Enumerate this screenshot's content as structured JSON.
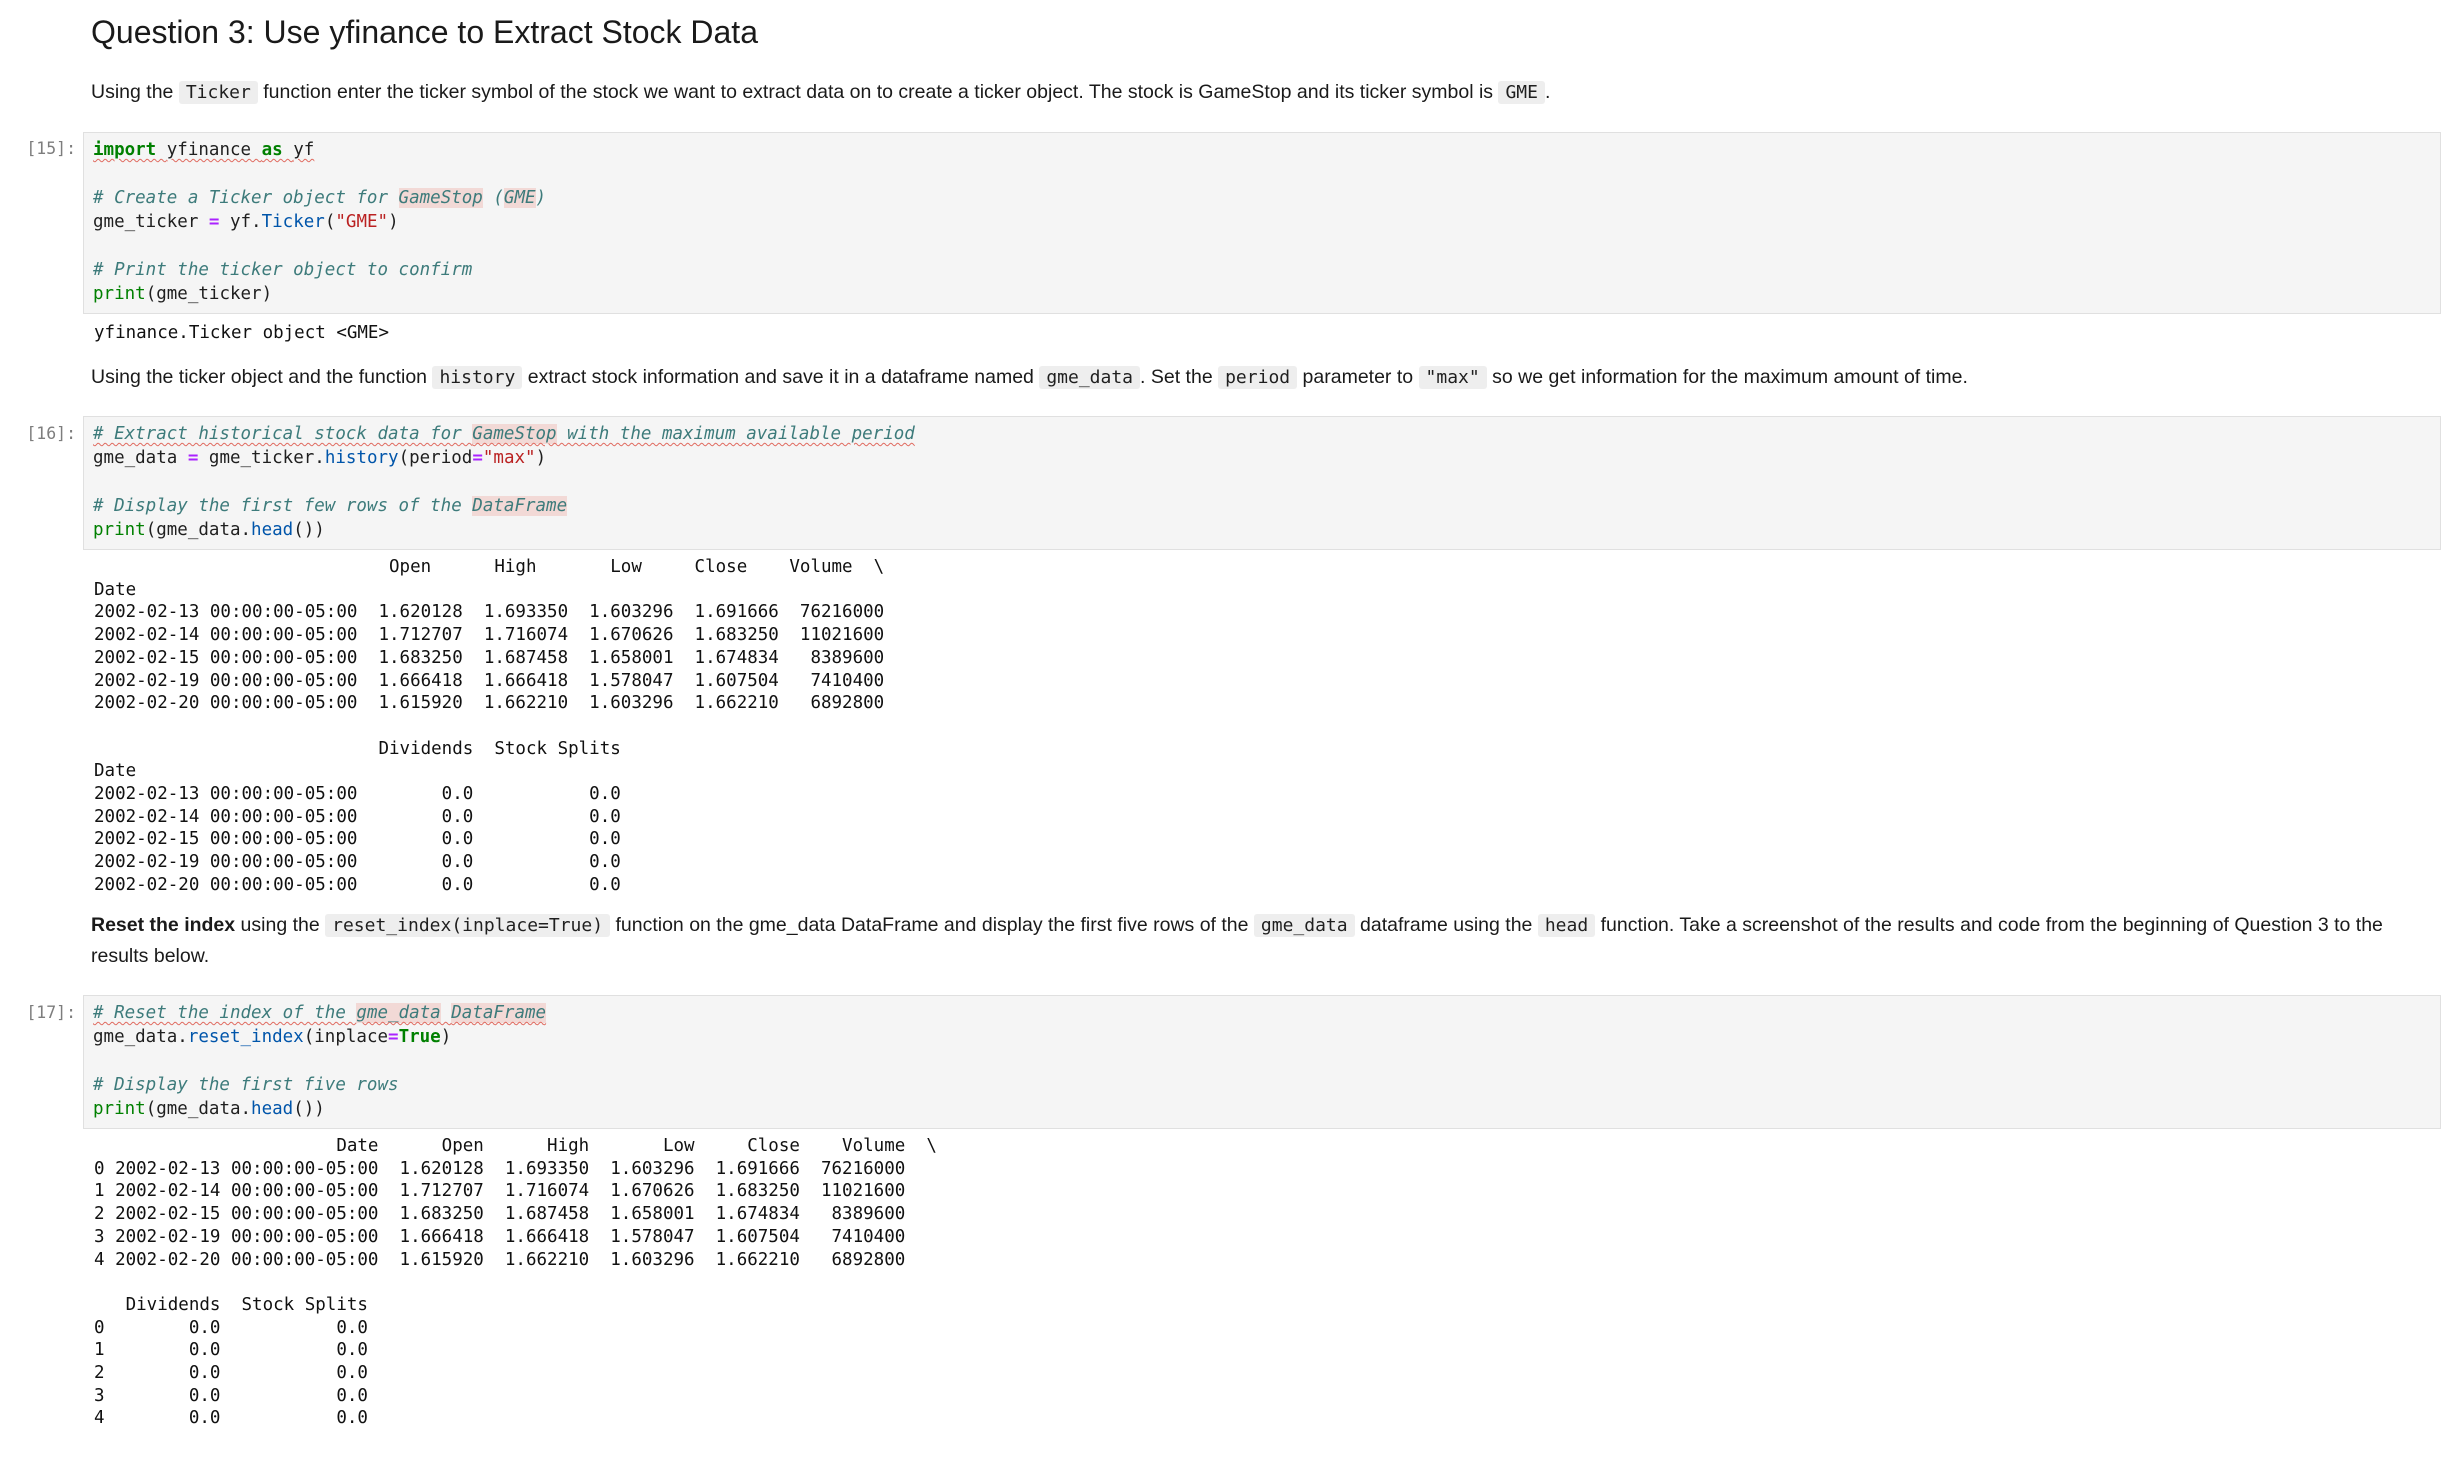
{
  "heading": "Question 3: Use yfinance to Extract Stock Data",
  "md1": {
    "t1": "Using the ",
    "c1": "Ticker",
    "t2": " function enter the ticker symbol of the stock we want to extract data on to create a ticker object. The stock is GameStop and its ticker symbol is ",
    "c2": "GME",
    "t3": "."
  },
  "cell15": {
    "prompt": "[15]:",
    "l1_kw": "import",
    "l1_mod": "yfinance",
    "l1_as": "as",
    "l1_alias": "yf",
    "c1a": "# Create a Ticker object for ",
    "c1b": "GameStop",
    "c1c": " (",
    "c1d": "GME",
    "c1e": ")",
    "l2a": "gme_ticker ",
    "l2op": "=",
    "l2b": " yf.",
    "l2fn": "Ticker",
    "l2c": "(",
    "l2str": "\"GME\"",
    "l2d": ")",
    "c2": "# Print the ticker object to confirm",
    "l3fn": "print",
    "l3rest": "(gme_ticker)",
    "output": "yfinance.Ticker object <GME>"
  },
  "md2": {
    "t1": "Using the ticker object and the function ",
    "c1": "history",
    "t2": " extract stock information and save it in a dataframe named ",
    "c2": "gme_data",
    "t3": ". Set the ",
    "c3": "period",
    "t4": " parameter to ",
    "c4": "\"max\"",
    "t5": " so we get information for the maximum amount of time."
  },
  "cell16": {
    "prompt": "[16]:",
    "c1a": "# Extract historical stock data for ",
    "c1b": "GameStop",
    "c1c": " with the maximum available period",
    "l1a": "gme_data ",
    "l1op": "=",
    "l1b": " gme_ticker.",
    "l1fn": "history",
    "l1c": "(period",
    "l1op2": "=",
    "l1str": "\"max\"",
    "l1d": ")",
    "c2a": "# Display the first few rows of the ",
    "c2b": "DataFrame",
    "l2fn": "print",
    "l2a": "(gme_data.",
    "l2fn2": "head",
    "l2b": "())",
    "output": "                            Open      High       Low     Close    Volume  \\\nDate                                                                      \n2002-02-13 00:00:00-05:00  1.620128  1.693350  1.603296  1.691666  76216000\n2002-02-14 00:00:00-05:00  1.712707  1.716074  1.670626  1.683250  11021600\n2002-02-15 00:00:00-05:00  1.683250  1.687458  1.658001  1.674834   8389600\n2002-02-19 00:00:00-05:00  1.666418  1.666418  1.578047  1.607504   7410400\n2002-02-20 00:00:00-05:00  1.615920  1.662210  1.603296  1.662210   6892800\n\n                           Dividends  Stock Splits  \nDate                                                \n2002-02-13 00:00:00-05:00        0.0           0.0  \n2002-02-14 00:00:00-05:00        0.0           0.0  \n2002-02-15 00:00:00-05:00        0.0           0.0  \n2002-02-19 00:00:00-05:00        0.0           0.0  \n2002-02-20 00:00:00-05:00        0.0           0.0  "
  },
  "md3": {
    "b1": "Reset the index",
    "t1": " using the ",
    "c1": "reset_index(inplace=True)",
    "t2": " function on the gme_data DataFrame and display the first five rows of the ",
    "c2": "gme_data",
    "t3": " dataframe using the ",
    "c3": "head",
    "t4": " function. Take a screenshot of the results and code from the beginning of Question 3 to the results below."
  },
  "cell17": {
    "prompt": "[17]:",
    "c1a": "# Reset the index of the ",
    "c1b": "gme_data",
    "c1c": " ",
    "c1d": "DataFrame",
    "l1a": "gme_data.",
    "l1fn": "reset_index",
    "l1b": "(inplace",
    "l1op": "=",
    "l1kw": "True",
    "l1c": ")",
    "c2": "# Display the first five rows",
    "l2fn": "print",
    "l2a": "(gme_data.",
    "l2fn2": "head",
    "l2b": "())",
    "output": "                       Date      Open      High       Low     Close    Volume  \\\n0 2002-02-13 00:00:00-05:00  1.620128  1.693350  1.603296  1.691666  76216000\n1 2002-02-14 00:00:00-05:00  1.712707  1.716074  1.670626  1.683250  11021600\n2 2002-02-15 00:00:00-05:00  1.683250  1.687458  1.658001  1.674834   8389600\n3 2002-02-19 00:00:00-05:00  1.666418  1.666418  1.578047  1.607504   7410400\n4 2002-02-20 00:00:00-05:00  1.615920  1.662210  1.603296  1.662210   6892800\n\n   Dividends  Stock Splits  \n0        0.0           0.0  \n1        0.0           0.0  \n2        0.0           0.0  \n3        0.0           0.0  \n4        0.0           0.0  "
  }
}
